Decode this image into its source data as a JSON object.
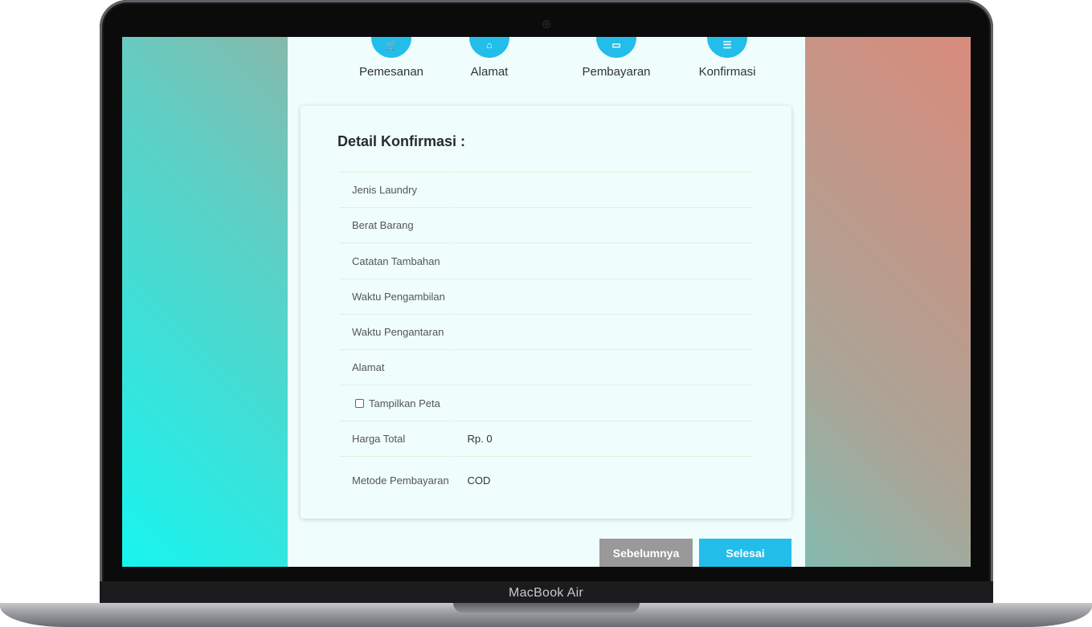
{
  "device": {
    "brand": "MacBook Air"
  },
  "steps": [
    {
      "label": "Pemesanan",
      "icon": "cart-icon"
    },
    {
      "label": "Alamat",
      "icon": "home-icon"
    },
    {
      "label": "Pembayaran",
      "icon": "card-icon"
    },
    {
      "label": "Konfirmasi",
      "icon": "receipt-icon"
    }
  ],
  "card": {
    "title": "Detail Konfirmasi :",
    "rows": [
      {
        "label": "Jenis Laundry",
        "value": ""
      },
      {
        "label": "Berat Barang",
        "value": ""
      },
      {
        "label": "Catatan Tambahan",
        "value": ""
      },
      {
        "label": "Waktu Pengambilan",
        "value": ""
      },
      {
        "label": "Waktu Pengantaran",
        "value": ""
      },
      {
        "label": "Alamat",
        "value": ""
      },
      {
        "label": "Tampilkan Peta",
        "value": "",
        "checkbox": false
      },
      {
        "label": "Harga Total",
        "value": "Rp. 0"
      },
      {
        "label": "Metode Pembayaran",
        "value": "COD"
      }
    ]
  },
  "buttons": {
    "previous": "Sebelumnya",
    "finish": "Selesai"
  },
  "colors": {
    "accent": "#23bdea",
    "secondary_button": "#999999",
    "page_bg": "#effdfd"
  }
}
